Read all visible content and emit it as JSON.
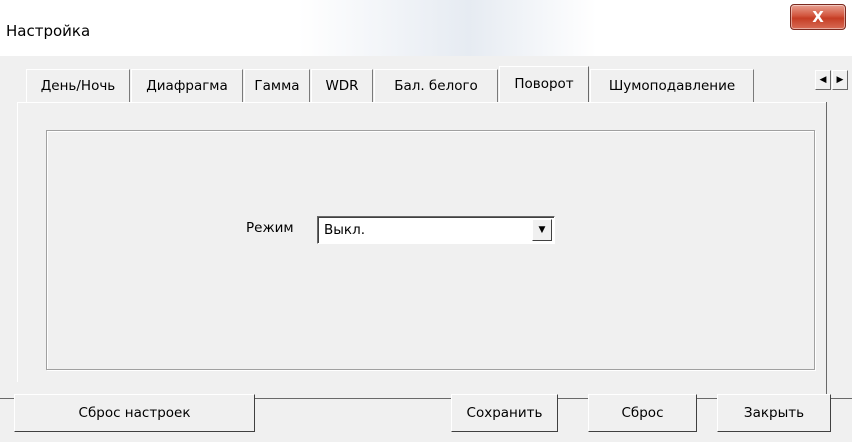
{
  "window": {
    "title": "Настройка",
    "close_label": "X"
  },
  "tabs": [
    {
      "label": "День/Ночь",
      "active": false
    },
    {
      "label": "Диафрагма",
      "active": false
    },
    {
      "label": "Гамма",
      "active": false
    },
    {
      "label": "WDR",
      "active": false
    },
    {
      "label": "Бал. белого",
      "active": false
    },
    {
      "label": "Поворот",
      "active": true
    },
    {
      "label": "Шумоподавление",
      "active": false
    }
  ],
  "tab_scroll": {
    "left_icon": "arrow-left-icon",
    "right_icon": "arrow-right-icon"
  },
  "panel": {
    "mode_label": "Режим",
    "mode_value": "Выкл."
  },
  "buttons": {
    "reset_settings": "Сброс настроек",
    "save": "Сохранить",
    "reset": "Сброс",
    "close": "Закрыть"
  }
}
